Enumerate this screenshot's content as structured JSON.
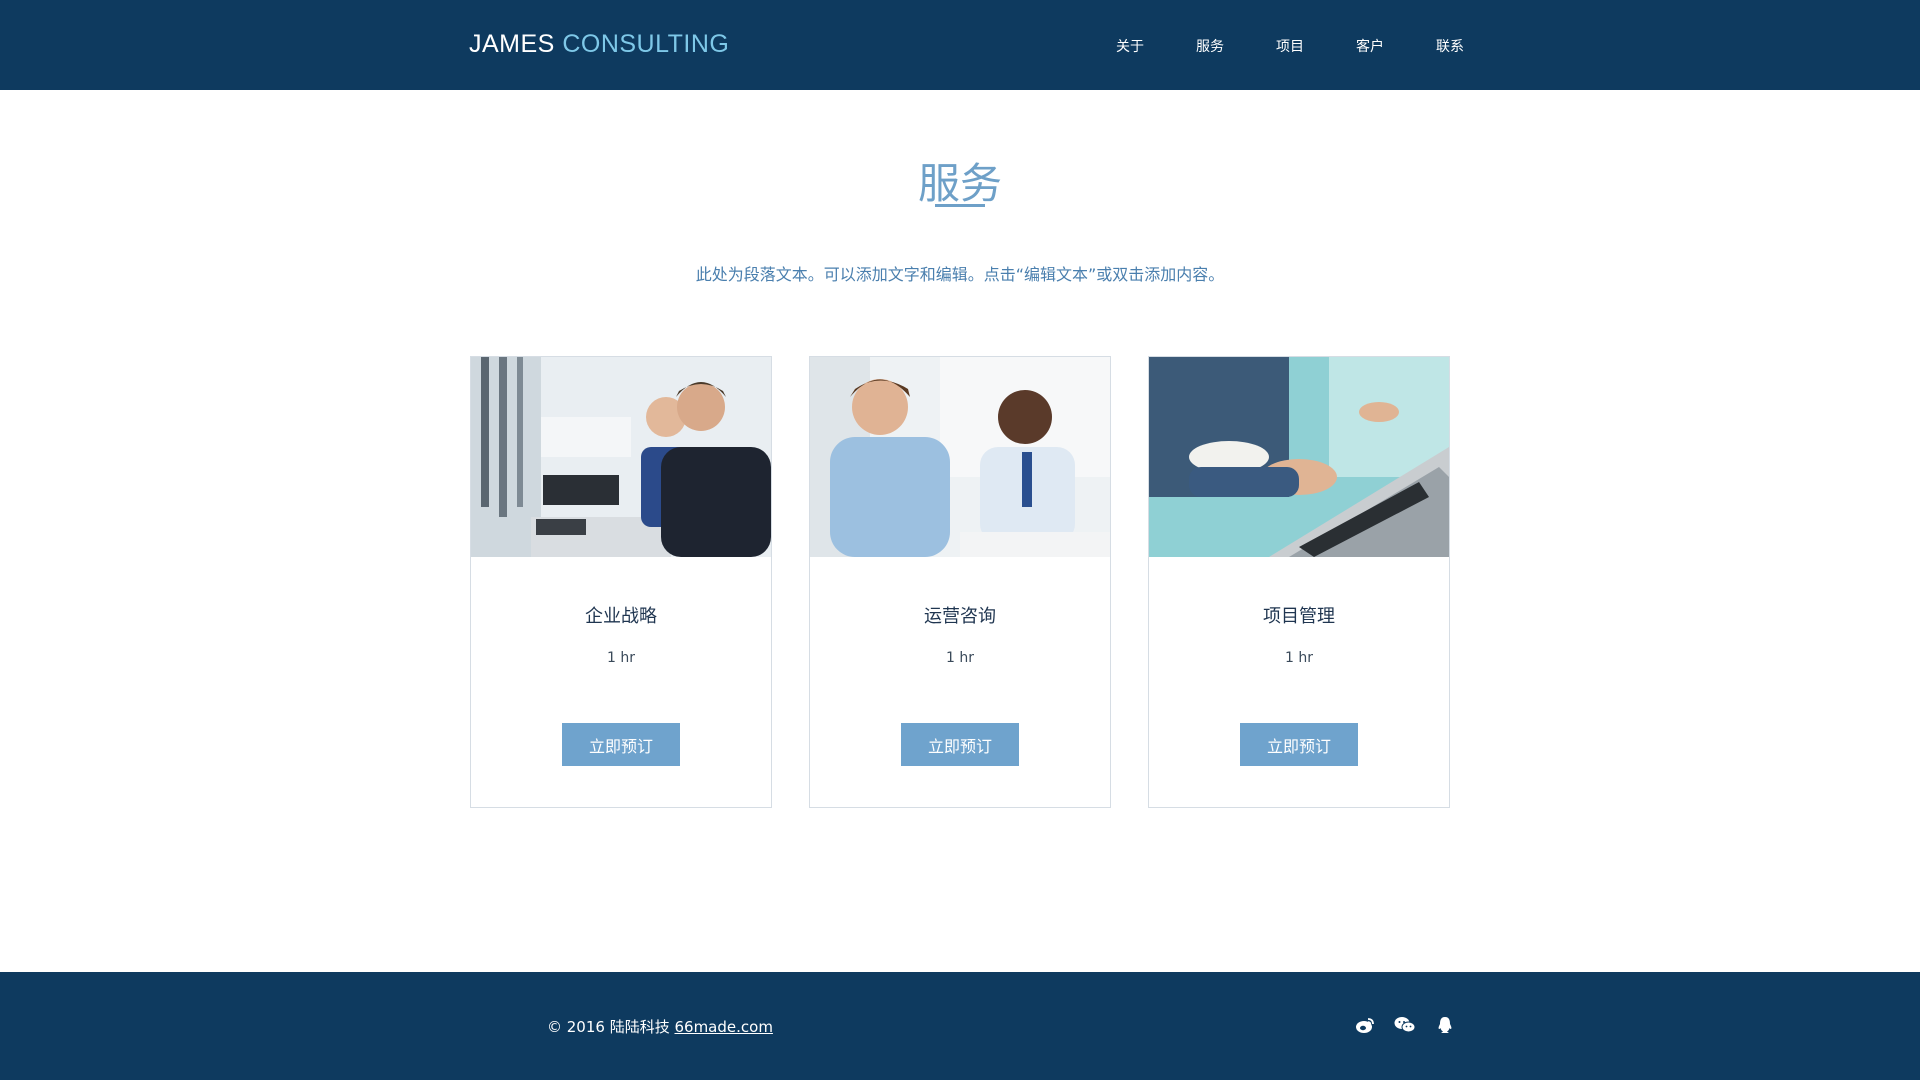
{
  "header": {
    "logo_part1": "JAMES",
    "logo_part2": "CONSULTING",
    "nav": [
      "关于",
      "服务",
      "项目",
      "客户",
      "联系"
    ]
  },
  "section": {
    "title": "服务",
    "intro": "此处为段落文本。可以添加文字和编辑。点击“编辑文本”或双击添加内容。"
  },
  "services": [
    {
      "name": "企业战略",
      "duration": "1 hr",
      "button": "立即预订",
      "photo_icon": "business-meeting-photo"
    },
    {
      "name": "运营咨询",
      "duration": "1 hr",
      "button": "立即预订",
      "photo_icon": "handshake-discussion-photo"
    },
    {
      "name": "项目管理",
      "duration": "1 hr",
      "button": "立即预订",
      "photo_icon": "laptop-typing-photo"
    }
  ],
  "footer": {
    "copyright_prefix": "© 2016 陆陆科技 ",
    "copyright_link": "66made.com",
    "social_icons": [
      "weibo-icon",
      "wechat-icon",
      "qq-icon"
    ]
  },
  "colors": {
    "header_bg": "#0e3a5f",
    "logo_accent": "#7ec8e8",
    "title_blue": "#6ea0c8",
    "button_bg": "#6fa3cd"
  }
}
